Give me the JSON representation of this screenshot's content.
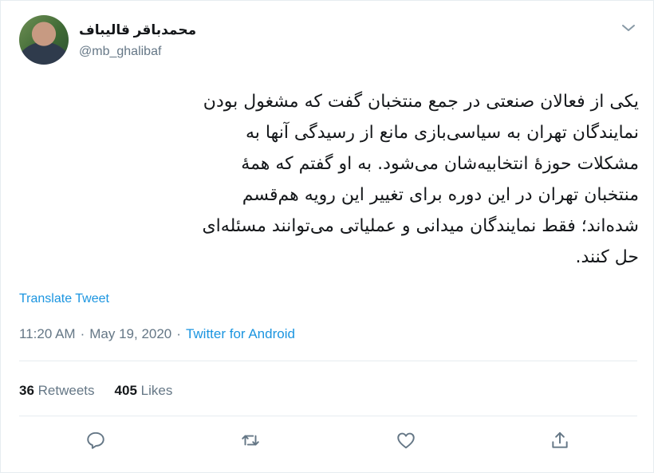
{
  "author": {
    "display_name": "محمدباقر قالیباف",
    "handle": "@mb_ghalibaf"
  },
  "tweet": {
    "text": "یکی از فعالان صنعتی در جمع منتخبان گفت که مشغول بودن\nنمایندگان تهران به سیاسی‌بازی مانع از رسیدگی آنها به\nمشکلات حوزۀ انتخابیه‌شان می‌شود. به او گفتم که همۀ\nمنتخبان تهران در این دوره برای تغییر این رویه هم‌قسم\nشده‌اند؛ فقط نمایندگان میدانی و عملیاتی می‌توانند مسئله‌ای\nحل کنند.",
    "translate_label": "Translate Tweet",
    "time": "11:20 AM",
    "date": "May 19, 2020",
    "separator": "·",
    "source": "Twitter for Android"
  },
  "stats": {
    "retweets_count": "36",
    "retweets_label": "Retweets",
    "likes_count": "405",
    "likes_label": "Likes"
  },
  "icons": {
    "caret": "chevron-down-icon",
    "reply": "reply-icon",
    "retweet": "retweet-icon",
    "like": "heart-icon",
    "share": "share-icon"
  },
  "colors": {
    "link": "#1b95e0",
    "secondary_text": "#657786",
    "divider": "#e6ecf0"
  }
}
